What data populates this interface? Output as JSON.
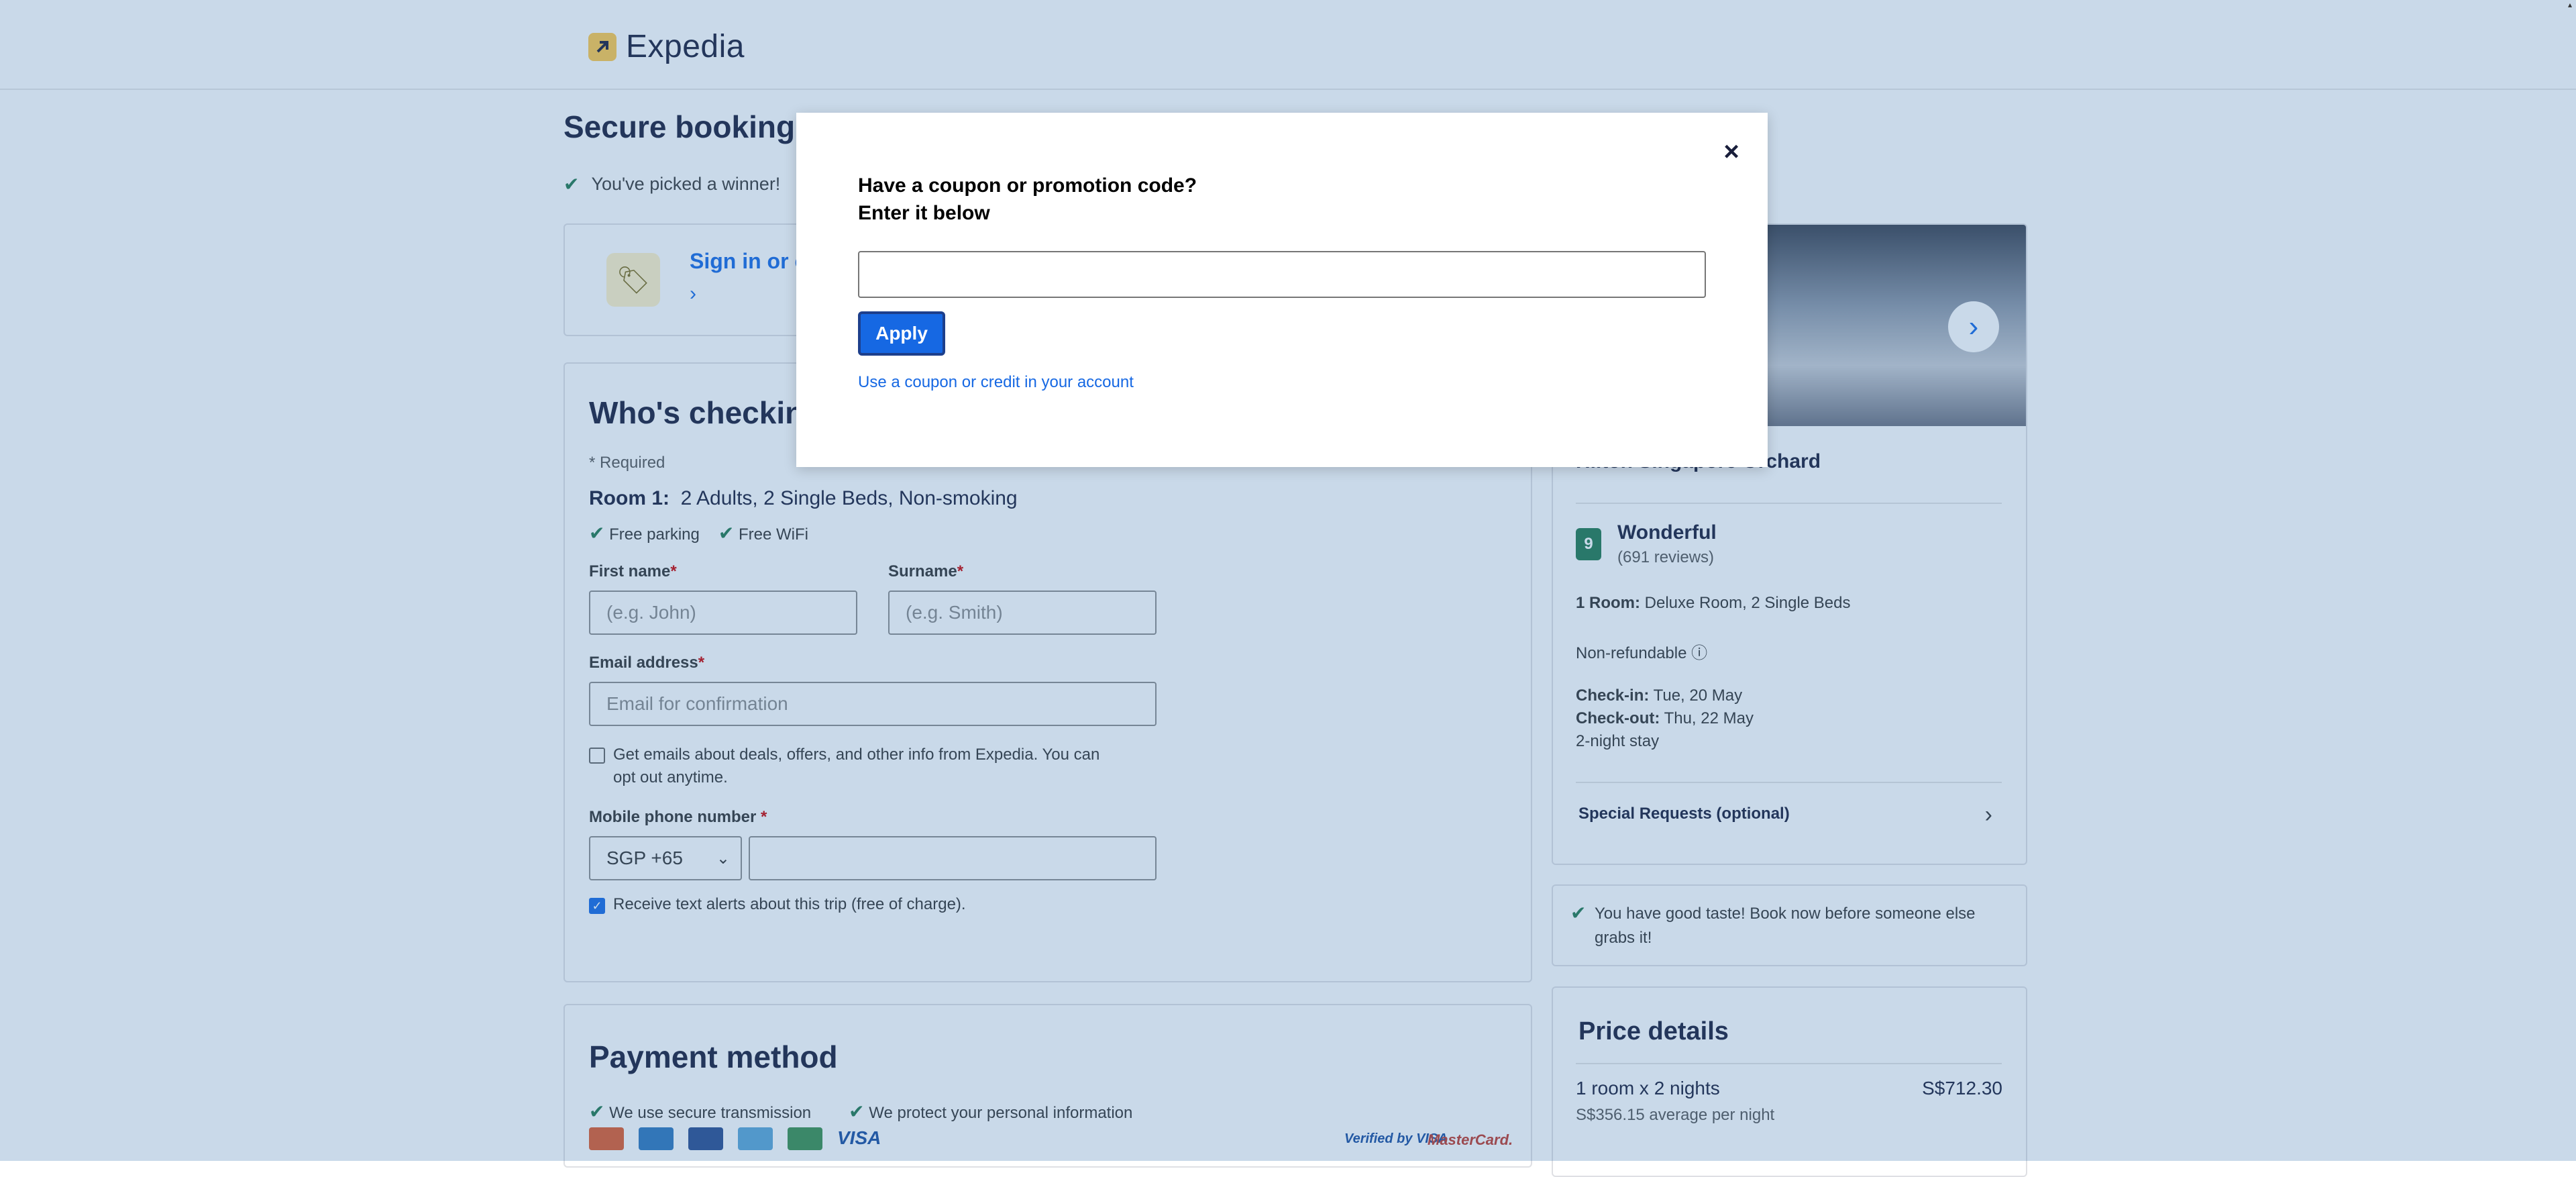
{
  "header": {
    "brand": "Expedia"
  },
  "page": {
    "title": "Secure booking",
    "winner_text": "You've picked a winner!",
    "signin_text": "Sign in or c"
  },
  "guest": {
    "title": "Who's checking",
    "required_note": "* Required",
    "room_label": "Room 1:",
    "room_desc": "2 Adults, 2 Single Beds, Non-smoking",
    "amenities": [
      "Free parking",
      "Free WiFi"
    ],
    "first_name_label": "First name",
    "first_name_placeholder": "(e.g. John)",
    "surname_label": "Surname",
    "surname_placeholder": "(e.g. Smith)",
    "email_label": "Email address",
    "email_placeholder": "Email for confirmation",
    "email_optin_line1": "Get emails about deals, offers, and other info from Expedia. You can",
    "email_optin_line2": "opt out anytime.",
    "phone_label": "Mobile phone number",
    "phone_country": "SGP +65",
    "sms_optin": "Receive text alerts about this trip (free of charge)."
  },
  "payment": {
    "title": "Payment method",
    "secure_1": "We use secure transmission",
    "secure_2": "We protect your personal information",
    "visa_label": "VISA",
    "verified_visa": "Verified by VISA",
    "mastercard": "MasterCard."
  },
  "hotel": {
    "name": "Hilton Singapore Orchard",
    "rating_score": "9",
    "rating_label": "Wonderful",
    "rating_reviews": "(691 reviews)",
    "room_label": "1 Room:",
    "room_value": "Deluxe Room, 2 Single Beds",
    "refund": "Non-refundable",
    "checkin_label": "Check-in:",
    "checkin_value": "Tue, 20 May",
    "checkout_label": "Check-out:",
    "checkout_value": "Thu, 22 May",
    "stay": "2-night stay",
    "special_requests": "Special Requests (optional)"
  },
  "good_taste": {
    "line1": "You have good taste! Book now before someone else",
    "line2": "grabs it!"
  },
  "price": {
    "title": "Price details",
    "row_label": "1 room x 2 nights",
    "row_amount": "S$712.30",
    "avg": "S$356.15 average per night"
  },
  "modal": {
    "heading_line1": "Have a coupon or promotion code?",
    "heading_line2": "Enter it below",
    "input_value": "",
    "apply_label": "Apply",
    "account_link": "Use a coupon or credit in your account",
    "close_glyph": "×"
  },
  "colors": {
    "accent": "#1668e3",
    "brand_yellow": "#ffc94c",
    "rating_green": "#227950",
    "overlay": "#3c76af"
  }
}
